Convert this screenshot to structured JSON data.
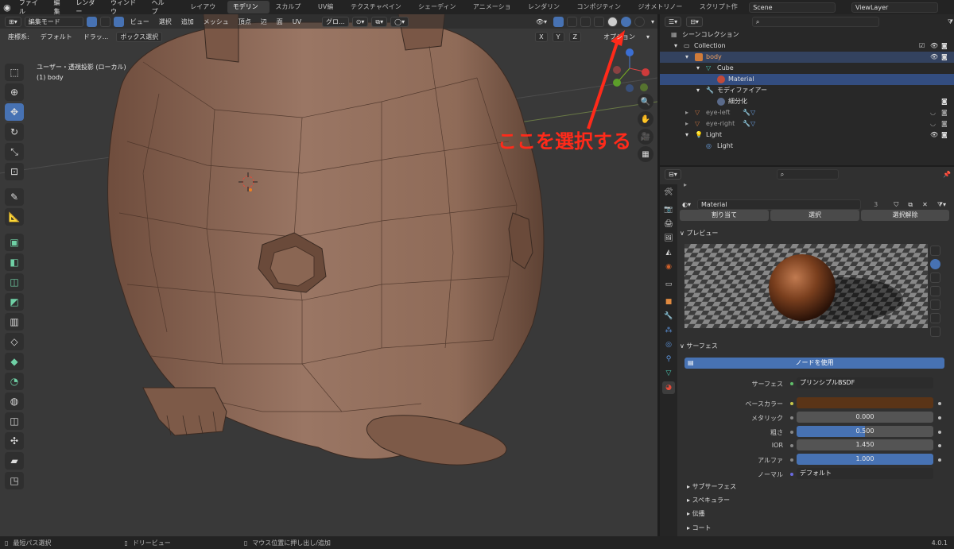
{
  "topbar": {
    "menus": [
      "ファイル",
      "編集",
      "レンダー",
      "ウィンドウ",
      "ヘルプ"
    ],
    "workspaces": [
      "レイアウト",
      "モデリング",
      "スカルプト",
      "UV編集",
      "テクスチャペイント",
      "シェーディング",
      "アニメーション",
      "レンダリング",
      "コンポジティング",
      "ジオメトリノード",
      "スクリプト作成"
    ],
    "active_workspace": "モデリング",
    "scene": "Scene",
    "view_layer": "ViewLayer"
  },
  "viewport": {
    "mode": "編集モード",
    "menus": [
      "ビュー",
      "選択",
      "追加",
      "メッシュ",
      "頂点",
      "辺",
      "面",
      "UV"
    ],
    "transform": "グロ...",
    "orientation_label": "座標系:",
    "orientation_value": "デフォルト",
    "drag_label": "ドラッ...",
    "drag_value": "ボックス選択",
    "axes": [
      "X",
      "Y",
      "Z"
    ],
    "options": "オプション",
    "info_line1": "ユーザー・透視投影 (ローカル)",
    "info_line2": "(1) body",
    "annotation": "ここを選択する",
    "annotation_color": "#ff2a1a"
  },
  "outliner": {
    "search_placeholder": "",
    "rows": [
      {
        "label": "シーンコレクション",
        "indent": 0
      },
      {
        "label": "Collection",
        "indent": 1
      },
      {
        "label": "body",
        "indent": 2
      },
      {
        "label": "Cube",
        "indent": 3
      },
      {
        "label": "Material",
        "indent": 4
      },
      {
        "label": "モディファイアー",
        "indent": 3
      },
      {
        "label": "細分化",
        "indent": 4
      },
      {
        "label": "eye-left",
        "indent": 2
      },
      {
        "label": "eye-right",
        "indent": 2
      },
      {
        "label": "Light",
        "indent": 2
      },
      {
        "label": "Light",
        "indent": 3
      }
    ]
  },
  "properties": {
    "material_name": "Material",
    "user_count": "3",
    "slot_buttons": [
      "割り当て",
      "選択",
      "選択解除"
    ],
    "preview_header": "プレビュー",
    "surface_header": "サーフェス",
    "use_nodes": "ノードを使用",
    "surface_label": "サーフェス",
    "surface_value": "プリンシプルBSDF",
    "fields": [
      {
        "label": "ベースカラー",
        "value": "",
        "fill": 0
      },
      {
        "label": "メタリック",
        "value": "0.000",
        "fill": 0
      },
      {
        "label": "粗さ",
        "value": "0.500",
        "fill": 0.5
      },
      {
        "label": "IOR",
        "value": "1.450",
        "fill": 0
      },
      {
        "label": "アルファ",
        "value": "1.000",
        "fill": 1
      },
      {
        "label": "ノーマル",
        "value": "デフォルト",
        "fill": 0
      }
    ],
    "base_color": "#5a3417",
    "subpanels": [
      "サブサーフェス",
      "スペキュラー",
      "伝播",
      "コート"
    ]
  },
  "statusbar": {
    "left": "最短パス選択",
    "middle": "ドリービュー",
    "right": "マウス位置に押し出し/追加",
    "version": "4.0.1"
  }
}
